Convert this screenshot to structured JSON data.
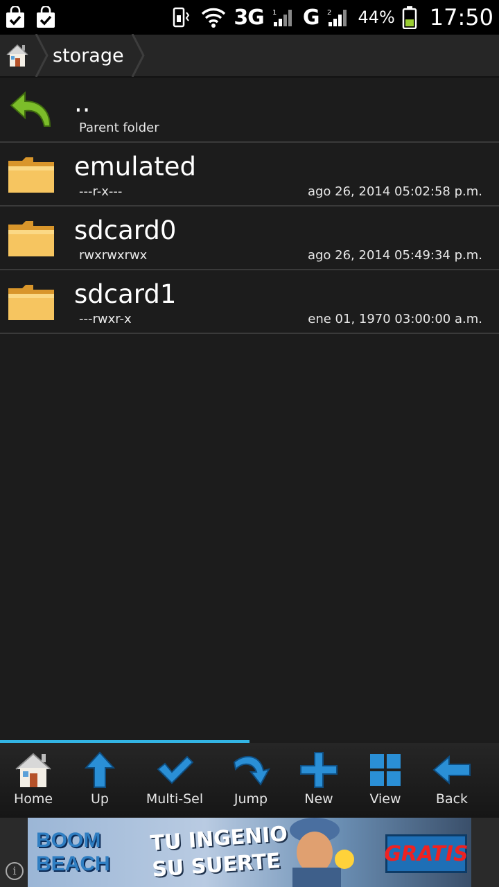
{
  "status_bar": {
    "network": "3G",
    "network2": "G",
    "sim1": "1",
    "sim2": "2",
    "battery_percent": "44%",
    "time": "17:50"
  },
  "breadcrumb": {
    "path": "storage"
  },
  "list": {
    "items": [
      {
        "name": "..",
        "permissions": "Parent folder",
        "date": "",
        "icon": "back-arrow-icon"
      },
      {
        "name": "emulated",
        "permissions": "---r-x---",
        "date": "ago 26, 2014 05:02:58 p.m.",
        "icon": "folder-icon"
      },
      {
        "name": "sdcard0",
        "permissions": "rwxrwxrwx",
        "date": "ago 26, 2014 05:49:34 p.m.",
        "icon": "folder-icon"
      },
      {
        "name": "sdcard1",
        "permissions": "---rwxr-x",
        "date": "ene 01, 1970 03:00:00 a.m.",
        "icon": "folder-icon"
      }
    ]
  },
  "toolbar": {
    "home": "Home",
    "up": "Up",
    "multisel": "Multi-Sel",
    "jump": "Jump",
    "new": "New",
    "view": "View",
    "back": "Back"
  },
  "ad": {
    "brand_line1": "BOOM",
    "brand_line2": "BEACH",
    "tagline_line1": "TU INGENIO",
    "tagline_line2": "SU SUERTE",
    "cta": "GRATIS",
    "info": "i"
  },
  "colors": {
    "accent": "#33b5e5",
    "background": "#1c1c1c",
    "folder": "#f2b33d"
  }
}
